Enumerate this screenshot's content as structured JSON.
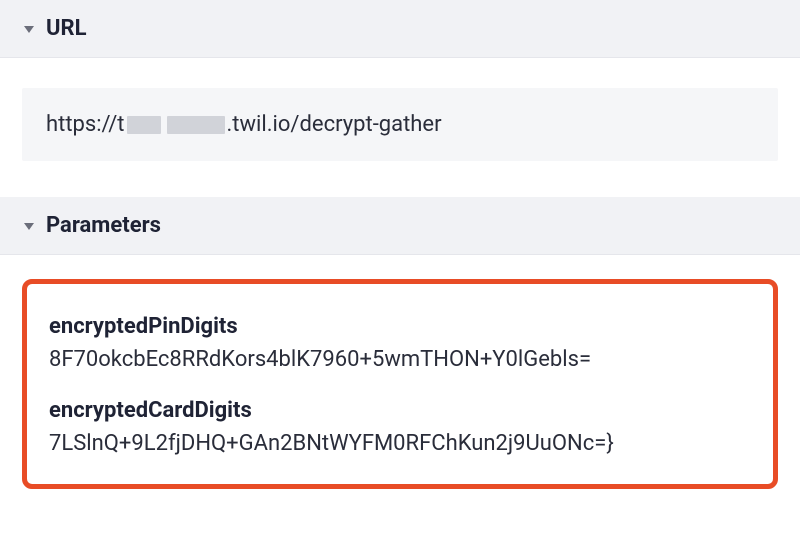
{
  "url_section": {
    "title": "URL",
    "url_prefix": "https://t",
    "url_suffix": ".twil.io/decrypt-gather"
  },
  "parameters_section": {
    "title": "Parameters",
    "items": [
      {
        "name": "encryptedPinDigits",
        "value": "8F70okcbEc8RRdKors4blK7960+5wmTHON+Y0lGebls="
      },
      {
        "name": "encryptedCardDigits",
        "value": "7LSlnQ+9L2fjDHQ+GAn2BNtWYFM0RFChKun2j9UuONc=}"
      }
    ]
  }
}
